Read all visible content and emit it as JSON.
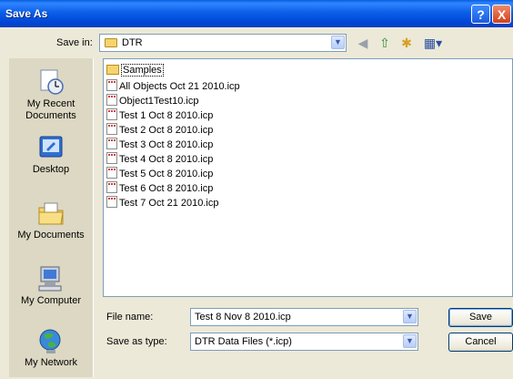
{
  "window": {
    "title": "Save As"
  },
  "savein": {
    "label": "Save in:",
    "folder": "DTR"
  },
  "places": [
    {
      "label": "My Recent\nDocuments",
      "icon": "recent-documents-icon"
    },
    {
      "label": "Desktop",
      "icon": "desktop-icon"
    },
    {
      "label": "My Documents",
      "icon": "my-documents-icon"
    },
    {
      "label": "My Computer",
      "icon": "my-computer-icon"
    },
    {
      "label": "My Network",
      "icon": "my-network-icon"
    }
  ],
  "files": [
    {
      "name": "Samples",
      "type": "folder"
    },
    {
      "name": "All Objects Oct 21 2010.icp",
      "type": "file"
    },
    {
      "name": "Object1Test10.icp",
      "type": "file"
    },
    {
      "name": "Test 1 Oct 8 2010.icp",
      "type": "file"
    },
    {
      "name": "Test 2 Oct 8 2010.icp",
      "type": "file"
    },
    {
      "name": "Test 3 Oct 8 2010.icp",
      "type": "file"
    },
    {
      "name": "Test 4 Oct 8 2010.icp",
      "type": "file"
    },
    {
      "name": "Test 5 Oct 8 2010.icp",
      "type": "file"
    },
    {
      "name": "Test 6 Oct 8 2010.icp",
      "type": "file"
    },
    {
      "name": "Test 7 Oct 21 2010.icp",
      "type": "file"
    }
  ],
  "filename": {
    "label": "File name:",
    "value": "Test 8 Nov 8 2010.icp"
  },
  "filetype": {
    "label": "Save as type:",
    "value": "DTR Data Files (*.icp)"
  },
  "buttons": {
    "save": "Save",
    "cancel": "Cancel",
    "help": "?",
    "close": "X"
  },
  "colors": {
    "titlebar": "#0a5fe0",
    "dialog": "#ece9d8",
    "places": "#dcd8c3"
  }
}
